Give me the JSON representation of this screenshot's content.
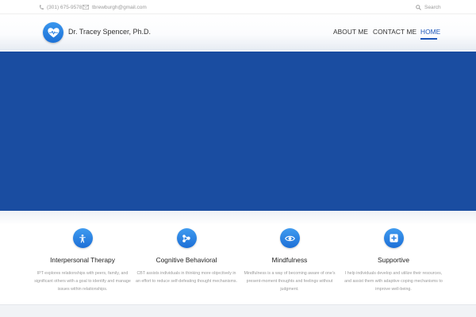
{
  "topbar": {
    "phone": "(301) 675-9578",
    "email": "tbrewburgh@gmail.com",
    "search_placeholder": "Search",
    "icons": {
      "phone": "phone-icon",
      "email": "envelope-icon",
      "search": "magnifier-icon"
    }
  },
  "header": {
    "brand_name": "Dr. Tracey Spencer, Ph.D.",
    "logo_icon": "heart-pulse-icon",
    "nav": {
      "about": "ABOUT ME",
      "contact": "CONTACT ME",
      "home": "HOME"
    },
    "active_nav": "HOME"
  },
  "hero": {
    "background_color": "#1a4da1"
  },
  "services": [
    {
      "title": "Interpersonal Therapy",
      "description": "IPT explores relationships with peers, family, and significant others with a goal to identify and manage issues within relationships.",
      "icon": "person-icon"
    },
    {
      "title": "Cognitive Behavioral",
      "description": "CBT assists individuals in thinking more objectively in an effort to reduce self-defeating thought mechanisms.",
      "icon": "network-icon"
    },
    {
      "title": "Mindfulness",
      "description": "Mindfulness is a way of becoming aware of one's present-moment thoughts and feelings without judgment.",
      "icon": "eye-icon"
    },
    {
      "title": "Supportive",
      "description": "I help individuals develop and utilize their resources, and assist them with adaptive coping mechanisms to improve well-being.",
      "icon": "plus-square-icon"
    }
  ],
  "colors": {
    "accent": "#1b55b8",
    "hero": "#1a4da1",
    "icon_circle": "#2a82e4",
    "muted_text": "#9a9a9a"
  }
}
